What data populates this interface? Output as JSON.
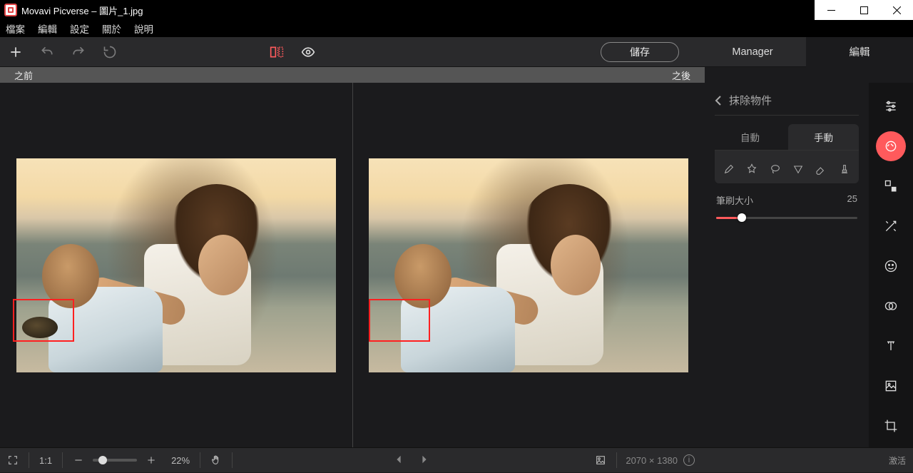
{
  "window": {
    "title": "Movavi Picverse – 圖片_1.jpg"
  },
  "menubar": {
    "items": [
      "檔案",
      "編輯",
      "設定",
      "關於",
      "說明"
    ]
  },
  "toolbar": {
    "save_label": "儲存",
    "mode_manager": "Manager",
    "mode_edit": "編輯"
  },
  "compare": {
    "before": "之前",
    "after": "之後"
  },
  "panel": {
    "title": "抹除物件",
    "subtab_auto": "自動",
    "subtab_manual": "手動",
    "brush_label": "筆刷大小",
    "brush_value": "25"
  },
  "footer": {
    "fit_label": "1:1",
    "zoom_pct": "22%",
    "dimensions": "2070 × 1380",
    "activate": "激活"
  }
}
